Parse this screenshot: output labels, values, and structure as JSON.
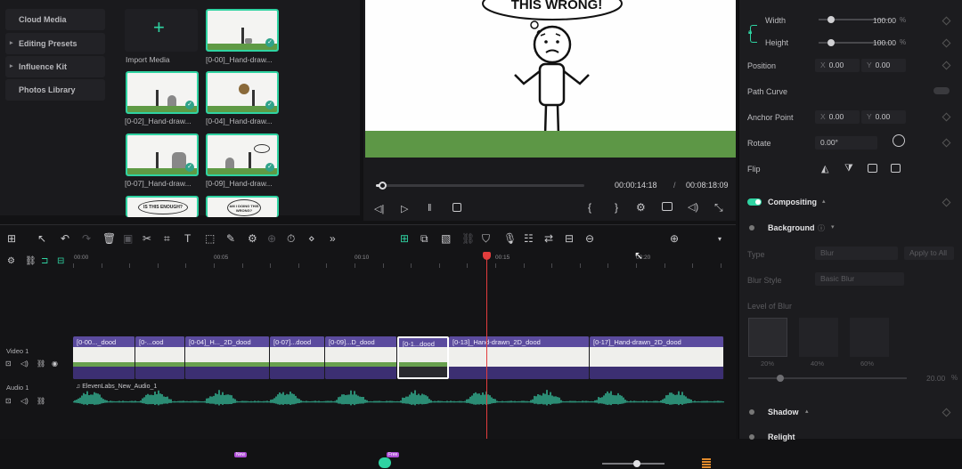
{
  "left_nav": {
    "items": [
      "Cloud Media",
      "Editing Presets",
      "Influence Kit",
      "Photos Library"
    ]
  },
  "media": {
    "import_label": "Import Media",
    "items": [
      "[0-00]_Hand-draw...",
      "[0-02]_Hand-draw...",
      "[0-04]_Hand-draw...",
      "[0-07]_Hand-draw...",
      "[0-09]_Hand-draw..."
    ],
    "bubble_texts": [
      "IS THIS ENOUGH?",
      "AM I DOING THIS WRONG?"
    ]
  },
  "preview": {
    "bubble_text": "THIS WRONG!",
    "current_time": "00:00:14:18",
    "separator": "/",
    "total_time": "00:08:18:09",
    "progress": 0.03
  },
  "properties": {
    "width_label": "Width",
    "width_value": "100.00",
    "width_unit": "%",
    "height_label": "Height",
    "height_value": "100.00",
    "height_unit": "%",
    "position_label": "Position",
    "pos_x": "0.00",
    "pos_y": "0.00",
    "path_curve_label": "Path Curve",
    "anchor_label": "Anchor Point",
    "anchor_x": "0.00",
    "anchor_y": "0.00",
    "rotate_label": "Rotate",
    "rotate_value": "0.00°",
    "flip_label": "Flip",
    "compositing_label": "Compositing",
    "background_label": "Background",
    "type_label": "Type",
    "type_value": "Blur",
    "apply_all": "Apply to All",
    "blur_style_label": "Blur Style",
    "blur_style_value": "Basic Blur",
    "level_label": "Level of Blur",
    "levels": [
      "20%",
      "40%",
      "60%"
    ],
    "level_value": "20.00",
    "level_unit": "%",
    "shadow_label": "Shadow",
    "relight_label": "Relight",
    "axis_x": "X",
    "axis_y": "Y"
  },
  "timeline": {
    "ruler": [
      "00:00",
      "00:05",
      "00:10",
      "00:15",
      "00:20"
    ],
    "video_track_label": "Video 1",
    "audio_track_label": "Audio 1",
    "audio_clip": "ElevenLabs_New_Audio_1",
    "clips": [
      "[0-00..._dood",
      "[0-...ood",
      "[0-04]_H..._2D_dood",
      "[0-07]...dood",
      "[0-09]...D_dood",
      "[0-1...dood",
      "[0-13]_Hand-drawn_2D_dood",
      "[0-17]_Hand-drawn_2D_dood"
    ],
    "badge_new": "New",
    "badge_free": "Free"
  }
}
